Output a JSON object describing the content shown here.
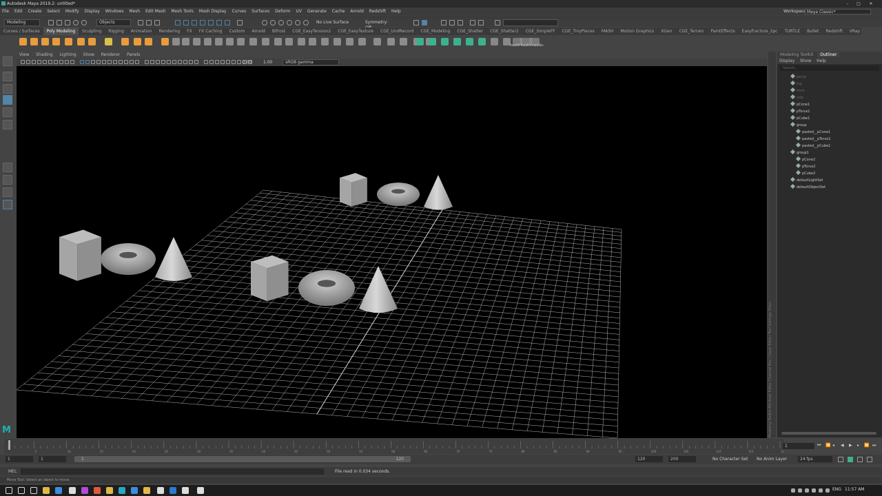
{
  "window": {
    "title": "Autodesk Maya 2019.2: untitled*"
  },
  "menubar": [
    "File",
    "Edit",
    "Create",
    "Select",
    "Modify",
    "Display",
    "Windows",
    "Mesh",
    "Edit Mesh",
    "Mesh Tools",
    "Mesh Display",
    "Curves",
    "Surfaces",
    "Deform",
    "UV",
    "Generate",
    "Cache",
    "Arnold",
    "Redshift",
    "Help"
  ],
  "workspace": {
    "label": "Workspace :",
    "value": "Maya Classic*"
  },
  "statusline": {
    "mode": "Modeling",
    "objects": "Objects",
    "live_surface": "No Live Surface",
    "symmetry": "Symmetry: Off"
  },
  "shelf_tabs": [
    "Curves / Surfaces",
    "Poly Modeling",
    "Sculpting",
    "Rigging",
    "Animation",
    "Rendering",
    "FX",
    "FX Caching",
    "Custom",
    "Arnold",
    "Bifrost",
    "CGE_EasyTension2",
    "CGE_EasyTexture",
    "CGE_UndRecord",
    "CGE_Modeling",
    "CGE_Shatter",
    "CGE_Shatter2",
    "CGE_SimpleFF",
    "CGE_TinyPieces",
    "MASH",
    "Motion Graphics",
    "XGen",
    "CGE_Terrain",
    "PaintEffects",
    "Easyfracture_2pc",
    "TURTLE",
    "Bullet",
    "Redshift",
    "VRay",
    "Toon",
    "Maxwell"
  ],
  "shelf_active": "Poly Modeling",
  "shelf_text": "AutoRif AutoFix AutoSkn",
  "panel_menu": [
    "View",
    "Shading",
    "Lighting",
    "Show",
    "Renderer",
    "Panels"
  ],
  "panel_toolbar": {
    "exposure": "0.00",
    "gamma": "1.00",
    "colorspace": "sRGB gamma"
  },
  "side_tabs": "Modeling Toolkit  Attribute Editor  Channel Box / Layer Editor  Tool Settings  XGen",
  "outliner": {
    "tabs": [
      "Modeling Toolkit",
      "Outliner"
    ],
    "active_tab": "Outliner",
    "menu": [
      "Display",
      "Show",
      "Help"
    ],
    "search_placeholder": "Search...",
    "items": [
      {
        "label": "persp",
        "indent": 0,
        "dim": true
      },
      {
        "label": "top",
        "indent": 0,
        "dim": true
      },
      {
        "label": "front",
        "indent": 0,
        "dim": true
      },
      {
        "label": "side",
        "indent": 0,
        "dim": true
      },
      {
        "label": "pCone1",
        "indent": 0,
        "dim": false
      },
      {
        "label": "pTorus1",
        "indent": 0,
        "dim": false
      },
      {
        "label": "pCube1",
        "indent": 0,
        "dim": false
      },
      {
        "label": "group",
        "indent": 0,
        "dim": false
      },
      {
        "label": "pasted__pCone1",
        "indent": 1,
        "dim": false
      },
      {
        "label": "pasted__pTorus1",
        "indent": 1,
        "dim": false
      },
      {
        "label": "pasted__pCube1",
        "indent": 1,
        "dim": false
      },
      {
        "label": "group1",
        "indent": 0,
        "dim": false
      },
      {
        "label": "pCone2",
        "indent": 1,
        "dim": false
      },
      {
        "label": "pTorus2",
        "indent": 1,
        "dim": false
      },
      {
        "label": "pCube2",
        "indent": 1,
        "dim": false
      },
      {
        "label": "defaultLightSet",
        "indent": 0,
        "dim": false
      },
      {
        "label": "defaultObjectSet",
        "indent": 0,
        "dim": false
      }
    ]
  },
  "timeline": {
    "current_frame": "1",
    "start": "1",
    "range_start": "1",
    "range_inner_start": "1",
    "range_inner_end": "120",
    "end": "120",
    "max": "200",
    "ticks": [
      "5",
      "10",
      "15",
      "20",
      "25",
      "30",
      "35",
      "40",
      "45",
      "50",
      "55",
      "60",
      "65",
      "70",
      "75",
      "80",
      "85",
      "90",
      "95",
      "100",
      "105",
      "110",
      "115",
      "120"
    ],
    "character_set": "No Character Set",
    "anim_layer": "No Anim Layer",
    "fps": "24 fps"
  },
  "cmdline": {
    "label": "MEL",
    "result": "File read in  0.034 seconds."
  },
  "helpline": "Move Tool: Select an object to move.",
  "taskbar": {
    "lang": "ENG",
    "time": "11:57 AM"
  },
  "colors": {
    "accent": "#5285a6",
    "shelf_orange": "#e89c3c",
    "shelf_teal": "#3fb08f"
  }
}
